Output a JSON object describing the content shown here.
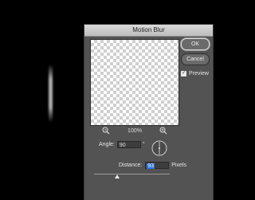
{
  "dialog": {
    "title": "Motion Blur",
    "ok_label": "OK",
    "cancel_label": "Cancel",
    "preview_label": "Preview",
    "preview_checked": true,
    "zoom_level": "100%",
    "angle_label": "Angle:",
    "angle_value": "90",
    "angle_unit": "°",
    "distance_label": "Distance:",
    "distance_value": "93",
    "distance_unit": "Pixels",
    "distance_slider_fraction": 0.3
  },
  "icons": {
    "zoom_out": "zoom-out-icon",
    "zoom_in": "zoom-in-icon",
    "angle_dial": "angle-dial-icon",
    "checkbox": "checkmark-icon"
  },
  "colors": {
    "dialog_bg": "#535353",
    "background": "#000000",
    "selection": "#2c6fd6"
  }
}
